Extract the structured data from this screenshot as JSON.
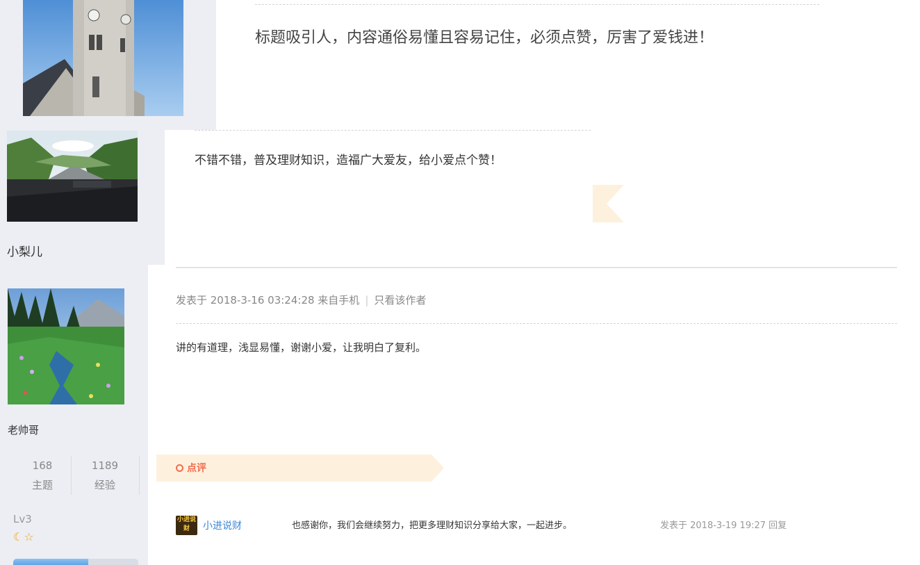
{
  "posts": [
    {
      "message": "标题吸引人，内容通俗易懂且容易记住，必须点赞，厉害了爱钱进！"
    },
    {
      "author": "小梨儿",
      "message": "不错不错，普及理财知识，造福广大爱友，给小爱点个赞！"
    },
    {
      "author": "老帅哥",
      "stats": [
        {
          "value": "168",
          "label": "主题"
        },
        {
          "value": "1189",
          "label": "经验"
        }
      ],
      "level": "Lv3",
      "level_icons": "☾☆",
      "level_progress": 0.6,
      "meta": {
        "posted": "发表于 2018-3-16 03:24:28 来自手机",
        "only_author": "只看该作者"
      },
      "message": "讲的有道理，浅显易懂，谢谢小爱，让我明白了复利。",
      "review": {
        "label": "点评",
        "comments": [
          {
            "avatar_text": "小进说财",
            "author": "小进说财",
            "text": "也感谢你，我们会继续努力，把更多理财知识分享给大家，一起进步。",
            "posted": "发表于 2018-3-19 19:27",
            "reply": "回复"
          }
        ]
      }
    }
  ],
  "colors": {
    "sidebar_bg": "#eceef4",
    "review_banner": "#fdf1de",
    "review_accent": "#f26c4f",
    "link_blue": "#3a86d8"
  }
}
